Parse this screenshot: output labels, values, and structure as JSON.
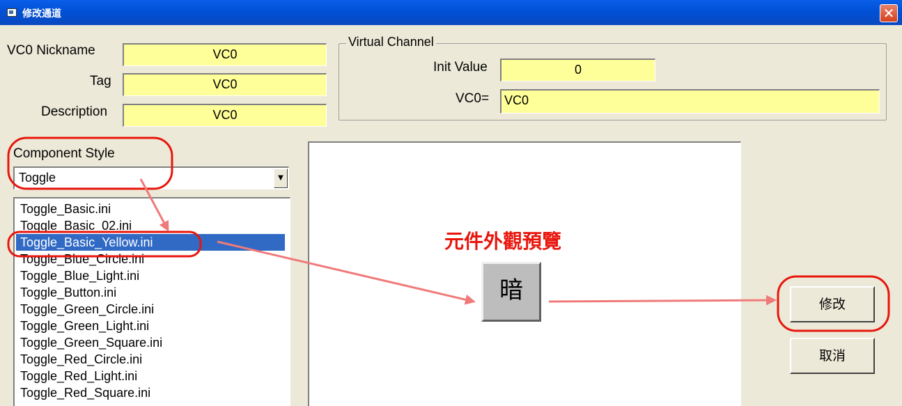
{
  "window": {
    "title": "修改通道",
    "close_glyph": "✕"
  },
  "fields": {
    "nickname": {
      "label": "VC0 Nickname",
      "value": "VC0"
    },
    "tag": {
      "label": "Tag",
      "value": "VC0"
    },
    "description": {
      "label": "Description",
      "value": "VC0"
    }
  },
  "virtual_channel": {
    "group_label": "Virtual Channel",
    "init_value": {
      "label": "Init Value",
      "value": "0"
    },
    "formula": {
      "label": "VC0=",
      "value": "VC0"
    }
  },
  "component_style": {
    "label": "Component Style",
    "selected": "Toggle",
    "files": [
      "Toggle_Basic.ini",
      "Toggle_Basic_02.ini",
      "Toggle_Basic_Yellow.ini",
      "Toggle_Blue_Circle.ini",
      "Toggle_Blue_Light.ini",
      "Toggle_Button.ini",
      "Toggle_Green_Circle.ini",
      "Toggle_Green_Light.ini",
      "Toggle_Green_Square.ini",
      "Toggle_Red_Circle.ini",
      "Toggle_Red_Light.ini",
      "Toggle_Red_Square.ini"
    ],
    "selected_file": "Toggle_Basic_Yellow.ini"
  },
  "preview": {
    "caption": "元件外觀預覽",
    "toggle_label": "暗"
  },
  "buttons": {
    "modify": "修改",
    "cancel": "取消"
  },
  "colors": {
    "field_bg": "#ffff99",
    "selection": "#316ac5",
    "annotation": "#e8150c",
    "arrow": "#f07a7a"
  }
}
